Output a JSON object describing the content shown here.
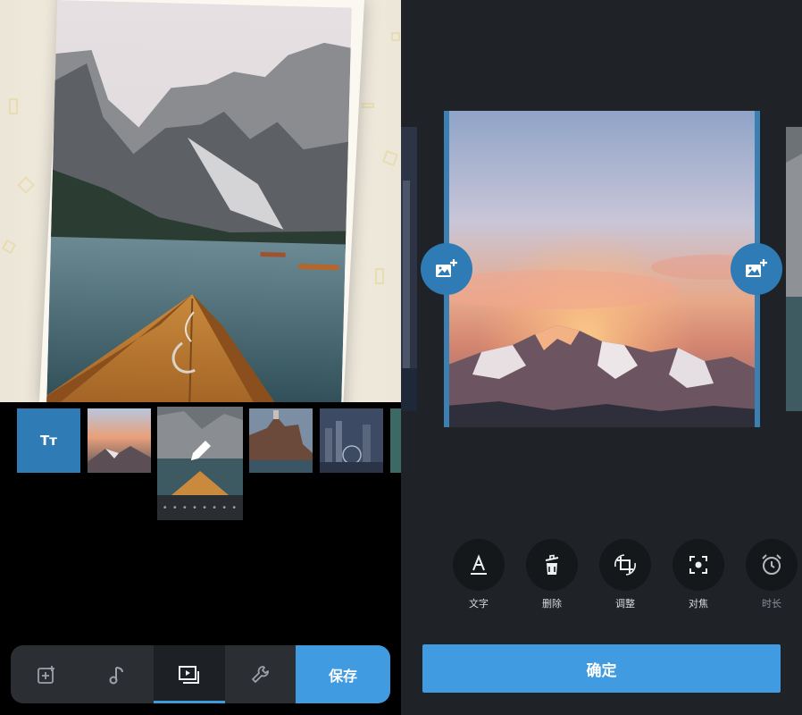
{
  "timeline": {
    "text_tile_label": "Tт"
  },
  "toolbar": {
    "save_label": "保存",
    "active_tab": "media"
  },
  "editor": {
    "tools": [
      {
        "label": "文字",
        "icon": "text-icon"
      },
      {
        "label": "删除",
        "icon": "delete-icon"
      },
      {
        "label": "调整",
        "icon": "crop-rotate-icon"
      },
      {
        "label": "对焦",
        "icon": "focus-icon"
      },
      {
        "label": "时长",
        "icon": "clock-icon"
      }
    ],
    "confirm_label": "确定"
  },
  "colors": {
    "accent": "#419be0",
    "accent_dark": "#2f7bb5",
    "panel_bg": "#1f2328"
  }
}
